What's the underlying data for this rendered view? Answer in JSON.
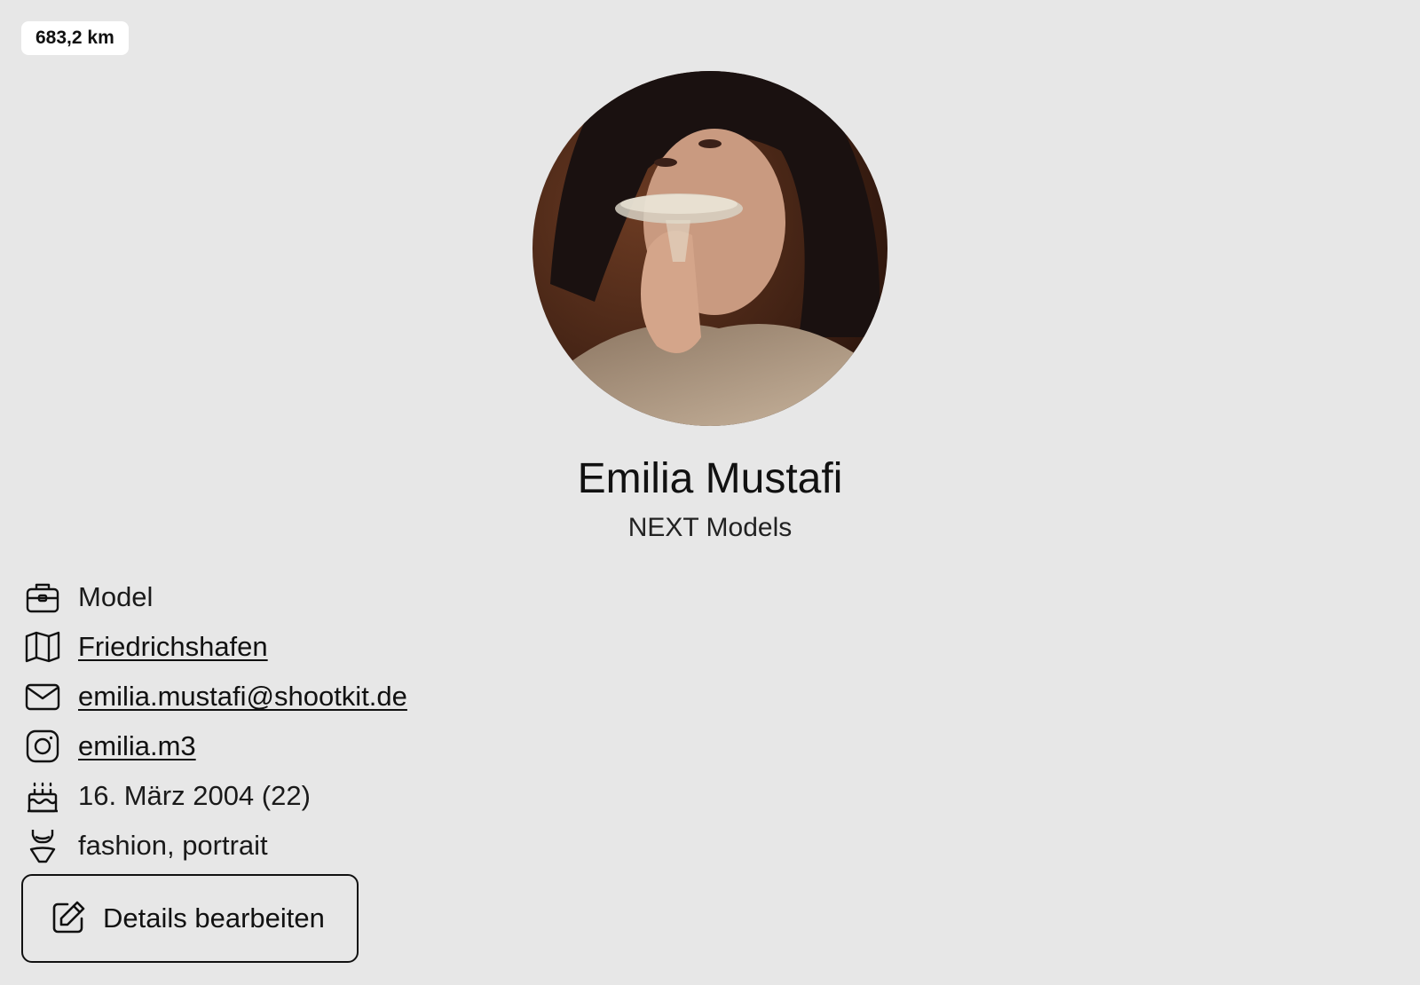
{
  "distance_badge": "683,2 km",
  "profile": {
    "name": "Emilia Mustafi",
    "agency": "NEXT Models"
  },
  "details": [
    {
      "icon": "briefcase-icon",
      "text": "Model",
      "link": false
    },
    {
      "icon": "map-icon",
      "text": "Friedrichshafen",
      "link": true
    },
    {
      "icon": "mail-icon",
      "text": "emilia.mustafi@shootkit.de",
      "link": true
    },
    {
      "icon": "instagram-icon",
      "text": "emilia.m3",
      "link": true
    },
    {
      "icon": "cake-icon",
      "text": "16. März 2004 (22)",
      "link": false
    },
    {
      "icon": "bikini-icon",
      "text": "fashion, portrait",
      "link": false
    }
  ],
  "edit_button": {
    "icon": "edit-icon",
    "label": "Details bearbeiten"
  },
  "colors": {
    "background": "#e7e7e7",
    "text": "#111111",
    "badge": "#ffffff"
  }
}
